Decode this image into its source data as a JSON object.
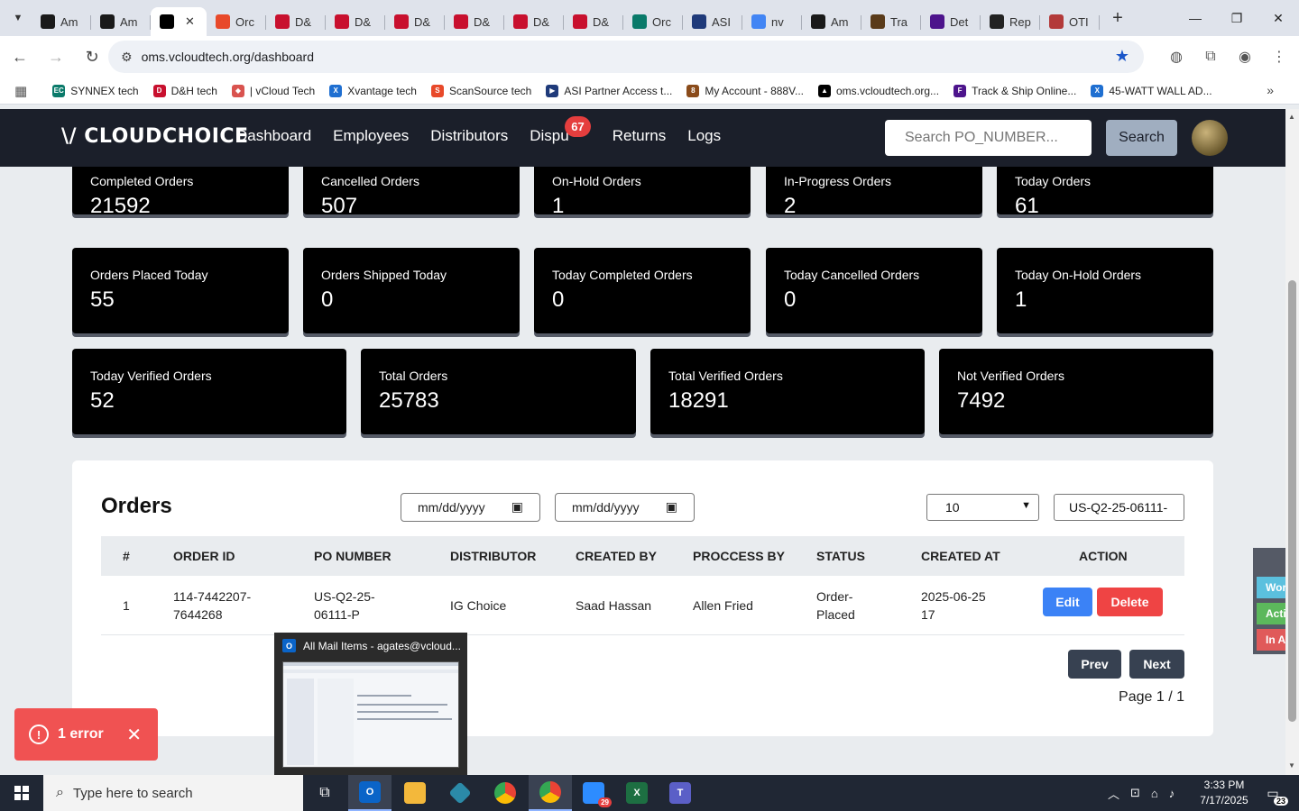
{
  "browser": {
    "tabs": [
      {
        "icon": "amazon-icon",
        "label": "Am",
        "color": "#1a1a1a"
      },
      {
        "icon": "amazon-icon",
        "label": "Am",
        "color": "#1a1a1a"
      },
      {
        "icon": "vcloud-icon",
        "label": "",
        "color": "#000000",
        "active": true
      },
      {
        "icon": "scansource-icon",
        "label": "Orc",
        "color": "#e8492a"
      },
      {
        "icon": "dh-icon",
        "label": "D&",
        "color": "#c8102e"
      },
      {
        "icon": "dh-icon",
        "label": "D&",
        "color": "#c8102e"
      },
      {
        "icon": "dh-icon",
        "label": "D&",
        "color": "#c8102e"
      },
      {
        "icon": "dh-icon",
        "label": "D&",
        "color": "#c8102e"
      },
      {
        "icon": "dh-icon",
        "label": "D&",
        "color": "#c8102e"
      },
      {
        "icon": "dh-icon",
        "label": "D&",
        "color": "#c8102e"
      },
      {
        "icon": "synnex-icon",
        "label": "Orc",
        "color": "#0a7a6a"
      },
      {
        "icon": "asi-icon",
        "label": "ASI",
        "color": "#1f3a7a"
      },
      {
        "icon": "google-icon",
        "label": "nv",
        "color": "#4285f4"
      },
      {
        "icon": "amazon-icon",
        "label": "Am",
        "color": "#1a1a1a"
      },
      {
        "icon": "ups-icon",
        "label": "Tra",
        "color": "#5a3b1a"
      },
      {
        "icon": "fedex-icon",
        "label": "Det",
        "color": "#4d148c"
      },
      {
        "icon": "rep-icon",
        "label": "Rep",
        "color": "#222222"
      },
      {
        "icon": "oti-icon",
        "label": "OTI",
        "color": "#b33a3a"
      }
    ],
    "url": "oms.vcloudtech.org/dashboard",
    "bookmarks": [
      {
        "label": "SYNNEX tech",
        "color": "#0a7a6a",
        "glyph": "EC"
      },
      {
        "label": "D&H tech",
        "color": "#c8102e",
        "glyph": "D"
      },
      {
        "label": "| vCloud Tech",
        "color": "#d9534f",
        "glyph": "◆"
      },
      {
        "label": "Xvantage tech",
        "color": "#1f6fd1",
        "glyph": "X"
      },
      {
        "label": "ScanSource tech",
        "color": "#e8492a",
        "glyph": "S"
      },
      {
        "label": "ASI Partner Access t...",
        "color": "#1f3a7a",
        "glyph": "▶"
      },
      {
        "label": "My Account - 888V...",
        "color": "#8a4b1a",
        "glyph": "8"
      },
      {
        "label": "oms.vcloudtech.org...",
        "color": "#000000",
        "glyph": "▲"
      },
      {
        "label": "Track & Ship Online...",
        "color": "#4d148c",
        "glyph": "F"
      },
      {
        "label": "45-WATT WALL AD...",
        "color": "#1f6fd1",
        "glyph": "X"
      }
    ]
  },
  "navbar": {
    "logo": "\\/ CLOUDCHOICE",
    "links": [
      "Dashboard",
      "Employees",
      "Distributors",
      "Dispu",
      "Returns",
      "Logs"
    ],
    "disputes_badge": "67",
    "search_placeholder": "Search PO_NUMBER...",
    "search_button": "Search"
  },
  "stats": {
    "row1": [
      {
        "label": "Completed Orders",
        "value": "21592"
      },
      {
        "label": "Cancelled Orders",
        "value": "507"
      },
      {
        "label": "On-Hold Orders",
        "value": "1"
      },
      {
        "label": "In-Progress Orders",
        "value": "2"
      },
      {
        "label": "Today Orders",
        "value": "61"
      }
    ],
    "row2": [
      {
        "label": "Orders Placed Today",
        "value": "55"
      },
      {
        "label": "Orders Shipped Today",
        "value": "0"
      },
      {
        "label": "Today Completed Orders",
        "value": "0"
      },
      {
        "label": "Today Cancelled Orders",
        "value": "0"
      },
      {
        "label": "Today On-Hold Orders",
        "value": "1"
      }
    ],
    "row3": [
      {
        "label": "Today Verified Orders",
        "value": "52"
      },
      {
        "label": "Total Orders",
        "value": "25783"
      },
      {
        "label": "Total Verified Orders",
        "value": "18291"
      },
      {
        "label": "Not Verified Orders",
        "value": "7492"
      }
    ]
  },
  "orders": {
    "title": "Orders",
    "date_from_placeholder": "mm/dd/yyyy",
    "date_to_placeholder": "mm/dd/yyyy",
    "page_size": "10",
    "filter_value": "US-Q2-25-06111-",
    "columns": [
      "#",
      "ORDER ID",
      "PO NUMBER",
      "DISTRIBUTOR",
      "CREATED BY",
      "PROCCESS BY",
      "STATUS",
      "CREATED AT",
      "ACTION"
    ],
    "rows": [
      {
        "num": "1",
        "order_id_1": "114-7442207-",
        "order_id_2": "7644268",
        "po_1": "US-Q2-25-",
        "po_2": "06111-P",
        "distributor": "IG Choice",
        "created_by": "Saad Hassan",
        "process_by": "Allen Fried",
        "status_1": "Order-",
        "status_2": "Placed",
        "created_at_1": "2025-06-25",
        "created_at_2": "17",
        "edit": "Edit",
        "delete": "Delete"
      }
    ],
    "prev": "Prev",
    "next": "Next",
    "page_info": "Page 1 / 1"
  },
  "side_widget": [
    {
      "label": "Workin",
      "color": "#5bc0de"
    },
    {
      "label": "Active",
      "color": "#5cb85c"
    },
    {
      "label": "In Acti",
      "color": "#e05a5a"
    }
  ],
  "toast": {
    "message": "1 error"
  },
  "preview": {
    "title": "All Mail Items - agates@vcloud..."
  },
  "taskbar": {
    "search_placeholder": "Type here to search",
    "time": "3:33 PM",
    "date": "7/17/2025",
    "notifications": "23",
    "zoom_badge": "29"
  }
}
